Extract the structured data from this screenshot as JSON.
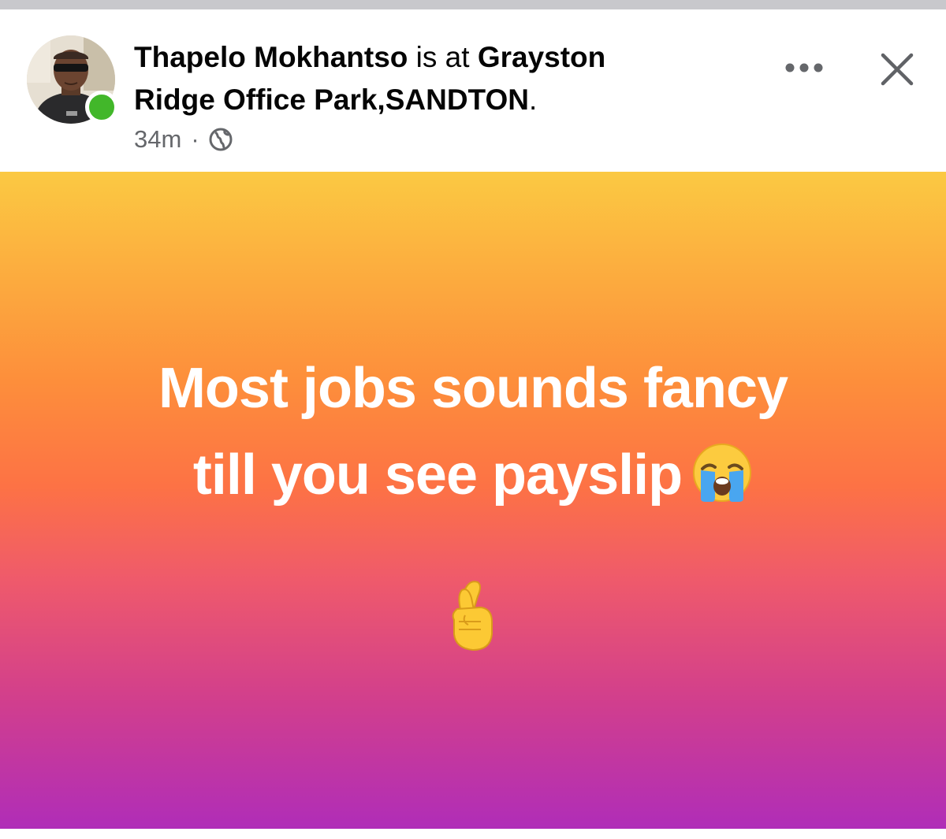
{
  "post": {
    "author_name": "Thapelo Mokhantso",
    "checkin_connector": " is at ",
    "location_line1": "Grayston",
    "location_line2": "Ridge Office Park,SANDTON",
    "location_end": ".",
    "timestamp": "34m",
    "separator": "·",
    "audience_icon": "globe-icon",
    "online_status": "online",
    "text_line1": "Most jobs sounds fancy",
    "text_line2": "till you see payslip",
    "emoji_line2": "loudly-crying-face-emoji",
    "emoji_line3": "crossed-fingers-emoji"
  },
  "actions": {
    "more_icon": "ellipsis-icon",
    "close_icon": "close-icon"
  },
  "colors": {
    "online": "#42b72a",
    "gradient_top": "#fbc942",
    "gradient_middle": "#fd7245",
    "gradient_bottom": "#b02db8",
    "text_primary": "#050505",
    "text_secondary": "#65676b"
  }
}
